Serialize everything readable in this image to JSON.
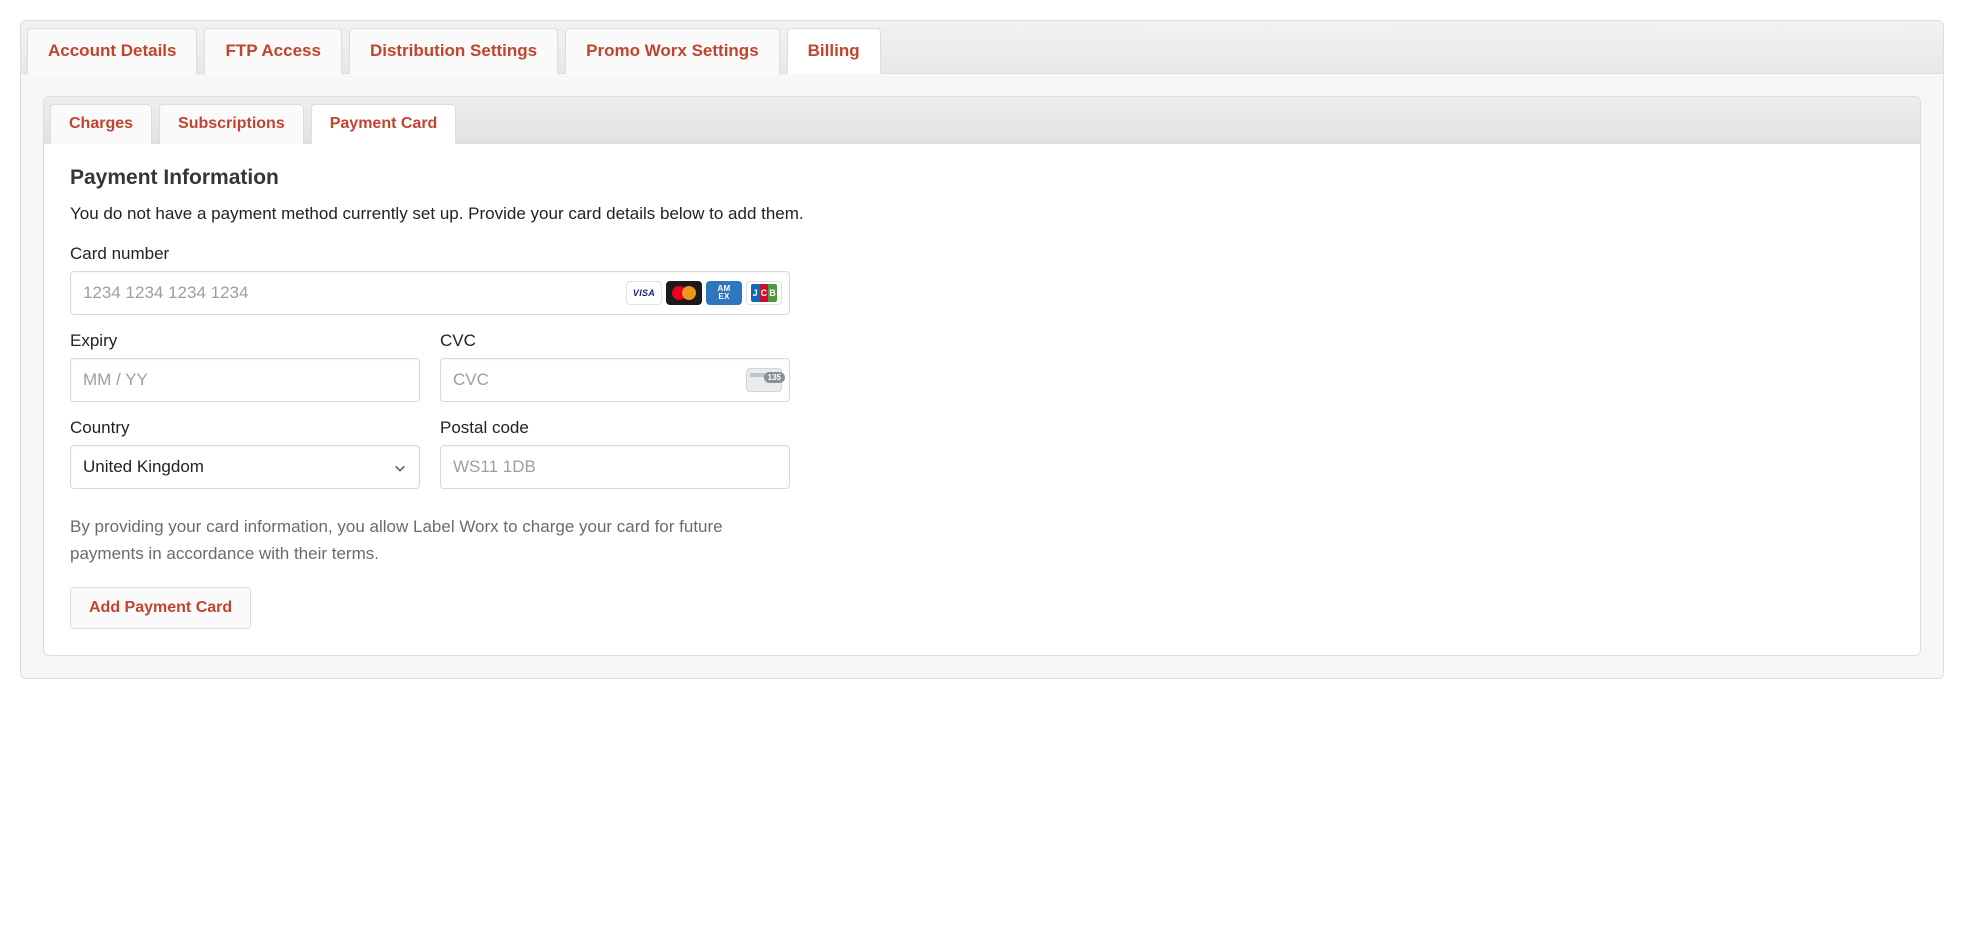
{
  "primaryTabs": {
    "items": [
      {
        "label": "Account Details"
      },
      {
        "label": "FTP Access"
      },
      {
        "label": "Distribution Settings"
      },
      {
        "label": "Promo Worx Settings"
      },
      {
        "label": "Billing"
      }
    ],
    "activeIndex": 4
  },
  "secondaryTabs": {
    "items": [
      {
        "label": "Charges"
      },
      {
        "label": "Subscriptions"
      },
      {
        "label": "Payment Card"
      }
    ],
    "activeIndex": 2
  },
  "section": {
    "title": "Payment Information",
    "intro": "You do not have a payment method currently set up. Provide your card details below to add them."
  },
  "form": {
    "cardNumber": {
      "label": "Card number",
      "placeholder": "1234 1234 1234 1234",
      "value": ""
    },
    "expiry": {
      "label": "Expiry",
      "placeholder": "MM / YY",
      "value": ""
    },
    "cvc": {
      "label": "CVC",
      "placeholder": "CVC",
      "value": ""
    },
    "country": {
      "label": "Country",
      "value": "United Kingdom"
    },
    "postalCode": {
      "label": "Postal code",
      "placeholder": "WS11 1DB",
      "value": ""
    }
  },
  "cardBrands": {
    "visa": "VISA",
    "amexLine1": "AM",
    "amexLine2": "EX",
    "jcbJ": "J",
    "jcbC": "C",
    "jcbB": "B"
  },
  "disclaimer": "By providing your card information, you allow Label Worx to charge your card for future payments in accordance with their terms.",
  "submitLabel": "Add Payment Card"
}
